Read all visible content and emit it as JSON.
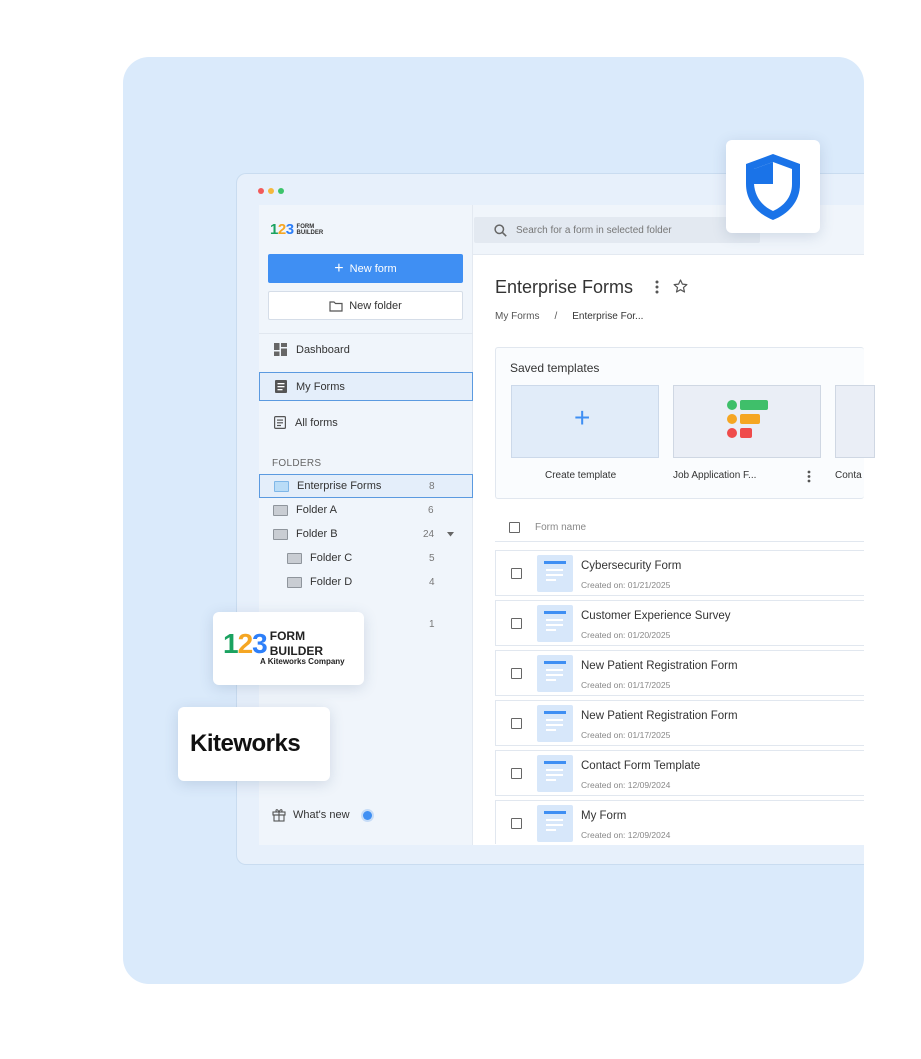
{
  "logo": {
    "numbers": "123",
    "line1": "FORM",
    "line2": "BUILDER"
  },
  "sidebar": {
    "new_form_label": "New form",
    "new_folder_label": "New folder",
    "nav": [
      {
        "label": "Dashboard",
        "icon": "dashboard-icon"
      },
      {
        "label": "My Forms",
        "icon": "forms-icon",
        "active": true
      },
      {
        "label": "All forms",
        "icon": "list-icon"
      }
    ],
    "folders_label": "FOLDERS",
    "folders": [
      {
        "name": "Enterprise Forms",
        "count": "8",
        "active": true
      },
      {
        "name": "Folder A",
        "count": "6"
      },
      {
        "name": "Folder B",
        "count": "24"
      },
      {
        "name": "Folder C",
        "count": "5"
      },
      {
        "name": "Folder D",
        "count": "4"
      }
    ],
    "extra_count": "1",
    "whats_new_label": "What's new"
  },
  "search": {
    "placeholder": "Search for a form in selected folder"
  },
  "main": {
    "title": "Enterprise Forms",
    "breadcrumb": {
      "root": "My Forms",
      "separator": "/",
      "current": "Enterprise For..."
    },
    "templates": {
      "heading": "Saved templates",
      "items": [
        {
          "label": "Create template"
        },
        {
          "label": "Job Application F..."
        },
        {
          "label": "Conta"
        }
      ]
    },
    "table": {
      "column_header": "Form name",
      "rows": [
        {
          "name": "Cybersecurity Form",
          "created": "Created on: 01/21/2025"
        },
        {
          "name": "Customer Experience Survey",
          "created": "Created on: 01/20/2025"
        },
        {
          "name": "New Patient Registration Form",
          "created": "Created on: 01/17/2025"
        },
        {
          "name": "New Patient Registration Form",
          "created": "Created on: 01/17/2025"
        },
        {
          "name": "Contact Form Template",
          "created": "Created on: 12/09/2024"
        },
        {
          "name": "My Form",
          "created": "Created on: 12/09/2024"
        }
      ]
    }
  },
  "badges": {
    "formbuilder": {
      "numbers": "123",
      "line1": "FORM",
      "line2": "BUILDER",
      "tagline": "A Kiteworks Company"
    },
    "kiteworks": "Kiteworks"
  },
  "colors": {
    "accent": "#3f8ff3",
    "one": "#1aa260",
    "two": "#f5a623",
    "three": "#2d7ff9",
    "shield": "#1a73e8"
  }
}
